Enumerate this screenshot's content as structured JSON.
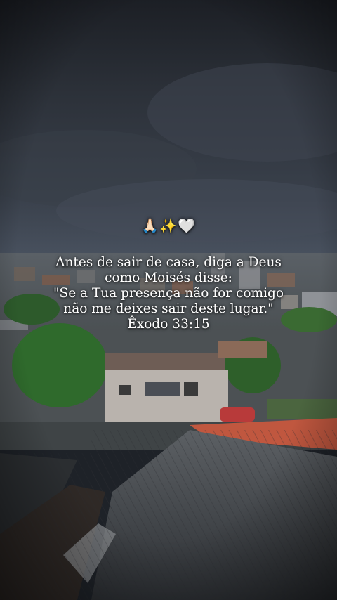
{
  "overlay": {
    "emojis": [
      "🙏🏻",
      "✨",
      "🤍"
    ],
    "lines": [
      "Antes de sair de casa, diga a Deus",
      "como Moisés disse:",
      "\"Se a Tua presença não for comigo",
      "não me deixes sair deste lugar.\"",
      "Êxodo 33:15"
    ]
  },
  "colors": {
    "sky_top": "#1f2329",
    "sky_mid": "#343a44",
    "horizon": "#4a5260",
    "roof_dark": "#3b3f44",
    "roof_red": "#c0573f",
    "tree_green": "#2f6a2c"
  }
}
